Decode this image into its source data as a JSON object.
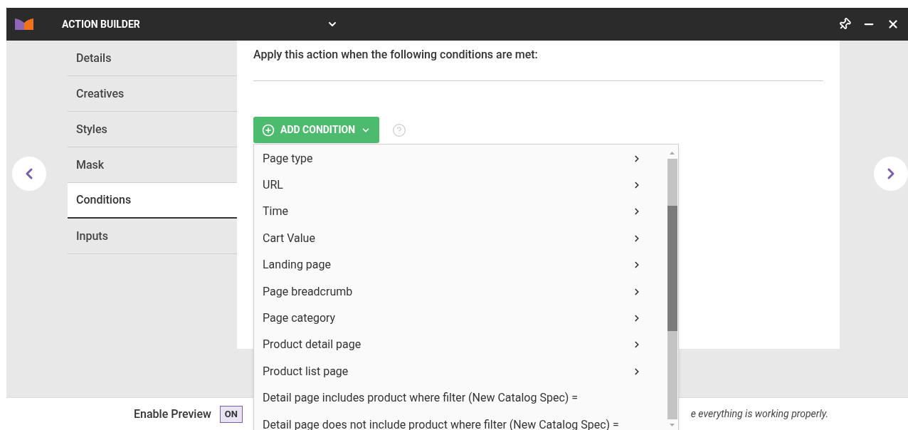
{
  "window": {
    "title": "ACTION BUILDER"
  },
  "sidebar": {
    "items": [
      {
        "label": "Details",
        "selected": false
      },
      {
        "label": "Creatives",
        "selected": false
      },
      {
        "label": "Styles",
        "selected": false
      },
      {
        "label": "Mask",
        "selected": false
      },
      {
        "label": "Conditions",
        "selected": true
      },
      {
        "label": "Inputs",
        "selected": false
      }
    ]
  },
  "content": {
    "heading": "Apply this action when the following conditions are met:",
    "add_button": "ADD CONDITION"
  },
  "dropdown": {
    "items": [
      {
        "label": "Page type",
        "kind": "submenu"
      },
      {
        "label": "URL",
        "kind": "submenu"
      },
      {
        "label": "Time",
        "kind": "submenu"
      },
      {
        "label": "Cart Value",
        "kind": "submenu"
      },
      {
        "label": "Landing page",
        "kind": "submenu"
      },
      {
        "label": "Page breadcrumb",
        "kind": "submenu"
      },
      {
        "label": "Page category",
        "kind": "submenu"
      },
      {
        "label": "Product detail page",
        "kind": "submenu"
      },
      {
        "label": "Product list page",
        "kind": "submenu"
      },
      {
        "label": "Detail page includes product where filter (New Catalog Spec) =",
        "kind": "plain"
      },
      {
        "label": "Detail page does not include product where filter (New Catalog Spec) =",
        "kind": "plain"
      }
    ]
  },
  "footer": {
    "preview_label": "Enable Preview",
    "toggle": {
      "label": "ON",
      "on": true
    },
    "note": "e everything is working properly."
  }
}
